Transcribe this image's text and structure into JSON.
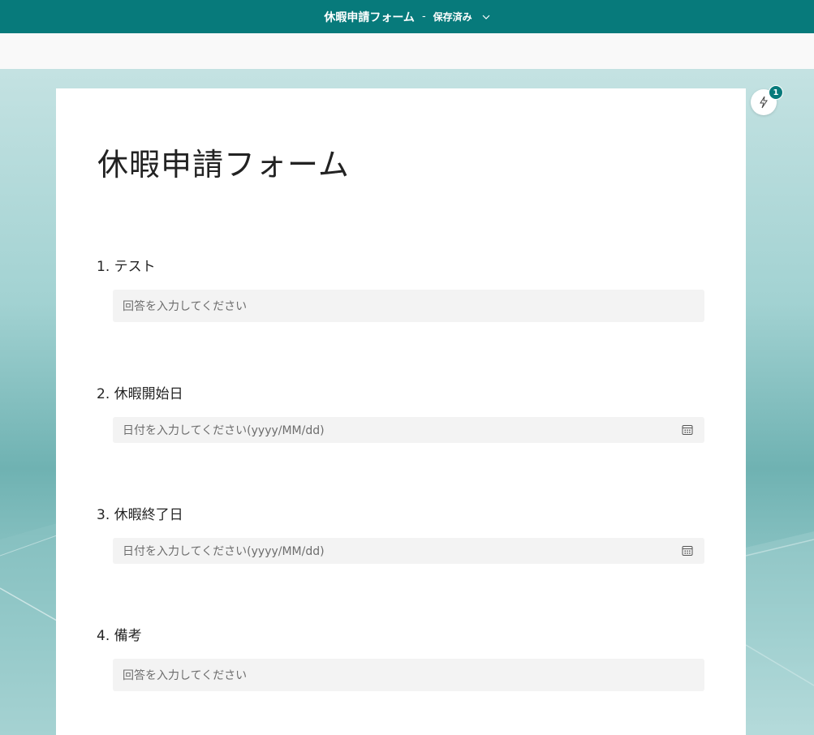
{
  "header": {
    "form_name": "休暇申請フォーム",
    "separator": "-",
    "save_status": "保存済み"
  },
  "ideas": {
    "badge_count": "1",
    "icon": "lightning-bolt-icon"
  },
  "form": {
    "title": "休暇申請フォーム",
    "questions": [
      {
        "label": "1. テスト",
        "placeholder": "回答を入力してください",
        "type": "text"
      },
      {
        "label": "2. 休暇開始日",
        "placeholder": "日付を入力してください(yyyy/MM/dd)",
        "type": "date"
      },
      {
        "label": "3. 休暇終了日",
        "placeholder": "日付を入力してください(yyyy/MM/dd)",
        "type": "date"
      },
      {
        "label": "4. 備考",
        "placeholder": "回答を入力してください",
        "type": "text"
      }
    ]
  },
  "colors": {
    "brand": "#077a7b",
    "input_bg": "#f3f3f3",
    "placeholder": "#6d6d6d"
  }
}
